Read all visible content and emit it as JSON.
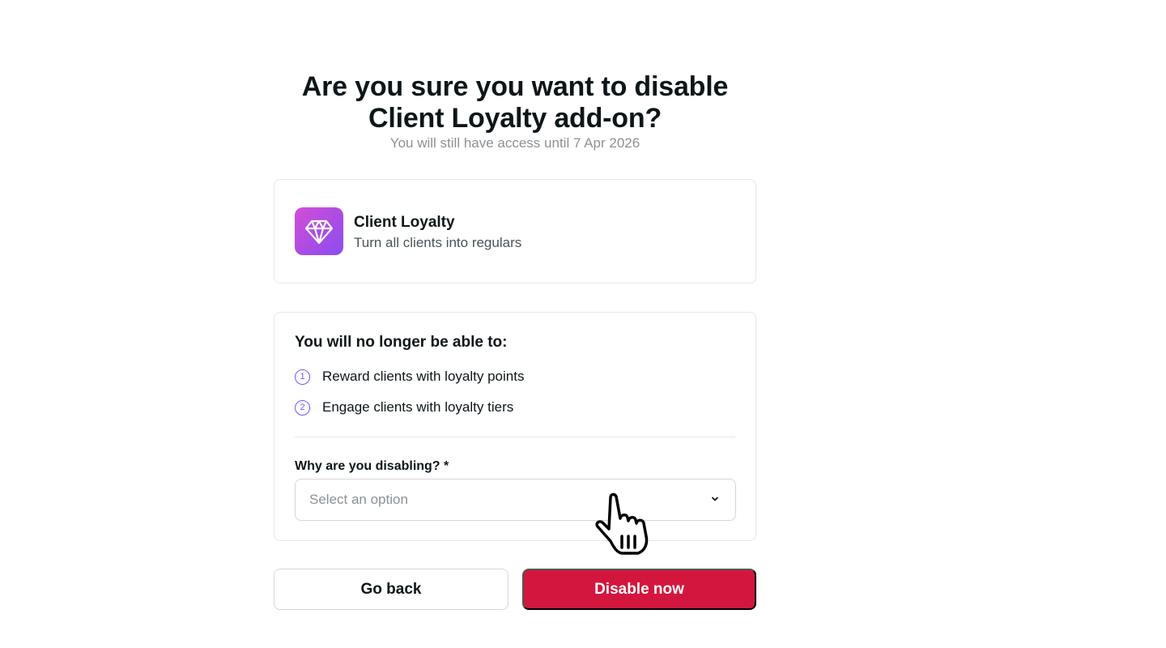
{
  "header": {
    "title": "Are you sure you want to disable Client Loyalty add-on?",
    "subtitle": "You will still have access until 7 Apr 2026"
  },
  "addon": {
    "icon": "diamond-icon",
    "name": "Client Loyalty",
    "description": "Turn all clients into regulars",
    "gradient_from": "#d24dd8",
    "gradient_to": "#8a4dee"
  },
  "loss": {
    "heading": "You will no longer be able to:",
    "items": [
      {
        "number": "1",
        "text": "Reward clients with loyalty points"
      },
      {
        "number": "2",
        "text": "Engage clients with loyalty tiers"
      }
    ],
    "accent": "#7357ff"
  },
  "reason": {
    "label": "Why are you disabling? *",
    "placeholder": "Select an option",
    "icon": "chevron-down-icon"
  },
  "actions": {
    "back_label": "Go back",
    "disable_label": "Disable now",
    "disable_color": "#d3163e"
  },
  "cursor": {
    "icon": "pointer-hand-icon"
  }
}
